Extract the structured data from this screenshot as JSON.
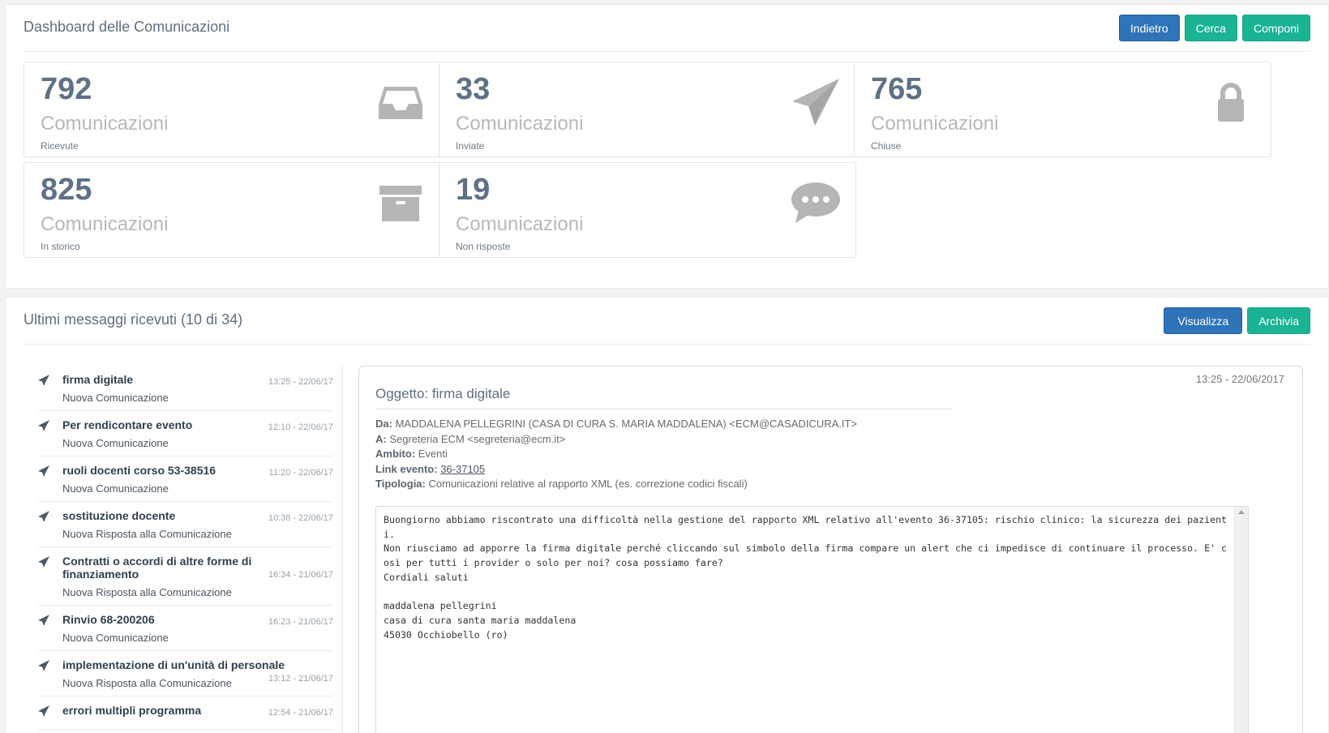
{
  "dashboard": {
    "title": "Dashboard delle Comunicazioni",
    "buttons": {
      "back": "Indietro",
      "search": "Cerca",
      "compose": "Componi"
    },
    "stats": [
      {
        "count": "792",
        "label": "Comunicazioni",
        "sub": "Ricevute",
        "icon": "inbox-icon"
      },
      {
        "count": "33",
        "label": "Comunicazioni",
        "sub": "Inviate",
        "icon": "paper-plane-icon"
      },
      {
        "count": "765",
        "label": "Comunicazioni",
        "sub": "Chiuse",
        "icon": "lock-icon"
      },
      {
        "count": "825",
        "label": "Comunicazioni",
        "sub": "In storico",
        "icon": "archive-icon"
      },
      {
        "count": "19",
        "label": "Comunicazioni",
        "sub": "Non risposte",
        "icon": "chat-bubble-icon"
      }
    ]
  },
  "messages": {
    "title": "Ultimi messaggi ricevuti (10 di 34)",
    "buttons": {
      "view": "Visualizza",
      "archive": "Archivia"
    },
    "list": [
      {
        "title": "firma digitale",
        "subtitle": "Nuova Comunicazione",
        "time": "13:25 - 22/06/17"
      },
      {
        "title": "Per rendicontare evento",
        "subtitle": "Nuova Comunicazione",
        "time": "12:10 - 22/06/17"
      },
      {
        "title": "ruoli docenti corso 53-38516",
        "subtitle": "Nuova Comunicazione",
        "time": "11:20 - 22/06/17"
      },
      {
        "title": "sostituzione docente",
        "subtitle": "Nuova Risposta alla Comunicazione",
        "time": "10:38 - 22/06/17"
      },
      {
        "title": "Contratti o accordi di altre forme di finanziamento",
        "subtitle": "Nuova Risposta alla Comunicazione",
        "time": "16:34 - 21/06/17"
      },
      {
        "title": "Rinvio 68-200206",
        "subtitle": "Nuova Comunicazione",
        "time": "16:23 - 21/06/17"
      },
      {
        "title": "implementazione di un'unità di personale",
        "subtitle": "Nuova Risposta alla Comunicazione",
        "time": "13:12 - 21/06/17"
      },
      {
        "title": "errori multipli programma",
        "subtitle": "",
        "time": "12:54 - 21/06/17"
      }
    ]
  },
  "detail": {
    "date": "13:25 - 22/06/2017",
    "subject": "Oggetto: firma digitale",
    "from_label": "Da:",
    "from": "MADDALENA PELLEGRINI (CASA DI CURA S. MARIA MADDALENA) <ECM@CASADICURA.IT>",
    "to_label": "A:",
    "to": "Segreteria ECM <segreteria@ecm.it>",
    "scope_label": "Ambito:",
    "scope": "Eventi",
    "event_label": "Link evento:",
    "event_link": "36-37105",
    "type_label": "Tipologia:",
    "type": "Comunicazioni relative al rapporto XML (es. correzione codici fiscali)",
    "body": "Buongiorno abbiamo riscontrato una difficoltà nella gestione del rapporto XML relativo all'evento 36-37105: rischio clinico: la sicurezza dei pazienti.\nNon riusciamo ad apporre la firma digitale perché cliccando sul simbolo della firma compare un alert che ci impedisce di continuare il processo. E' così per tutti i provider o solo per noi? cosa possiamo fare?\nCordiali saluti\n\nmaddalena pellegrini\ncasa di cura santa maria maddalena\n45030 Occhiobello (ro)"
  },
  "colors": {
    "primary": "#2f73b8",
    "success": "#1ab394",
    "icon_gray": "#b3b5b7"
  }
}
